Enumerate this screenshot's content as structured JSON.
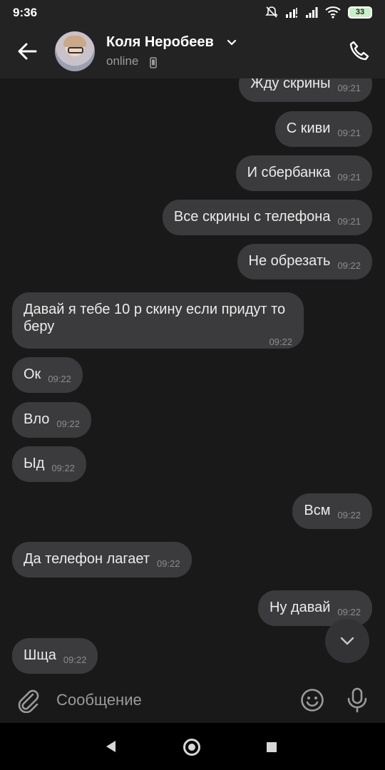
{
  "status_bar": {
    "time": "9:36",
    "battery": "33"
  },
  "header": {
    "contact_name": "Коля Неробеев",
    "presence": "online"
  },
  "messages": [
    {
      "side": "out",
      "text": "Жду скрины",
      "time": "09:21"
    },
    {
      "side": "out",
      "text": "С киви",
      "time": "09:21"
    },
    {
      "side": "out",
      "text": "И сбербанка",
      "time": "09:21"
    },
    {
      "side": "out",
      "text": "Все скрины с телефона",
      "time": "09:21"
    },
    {
      "side": "out",
      "text": "Не обрезать",
      "time": "09:22"
    },
    {
      "side": "in",
      "text": "Давай я тебе 10 р скину если придут то беру",
      "time": "09:22"
    },
    {
      "side": "in",
      "text": "Ок",
      "time": "09:22"
    },
    {
      "side": "in",
      "text": "Вло",
      "time": "09:22"
    },
    {
      "side": "in",
      "text": "Ыд",
      "time": "09:22"
    },
    {
      "side": "out",
      "text": "Всм",
      "time": "09:22"
    },
    {
      "side": "in",
      "text": "Да телефон лагает",
      "time": "09:22"
    },
    {
      "side": "out",
      "text": "Ну давай",
      "time": "09:22"
    },
    {
      "side": "in",
      "text": "Шща",
      "time": "09:22"
    }
  ],
  "composer": {
    "placeholder": "Сообщение"
  },
  "colors": {
    "background": "#19191a",
    "bubble": "#3b3b3d",
    "header": "#232324"
  }
}
